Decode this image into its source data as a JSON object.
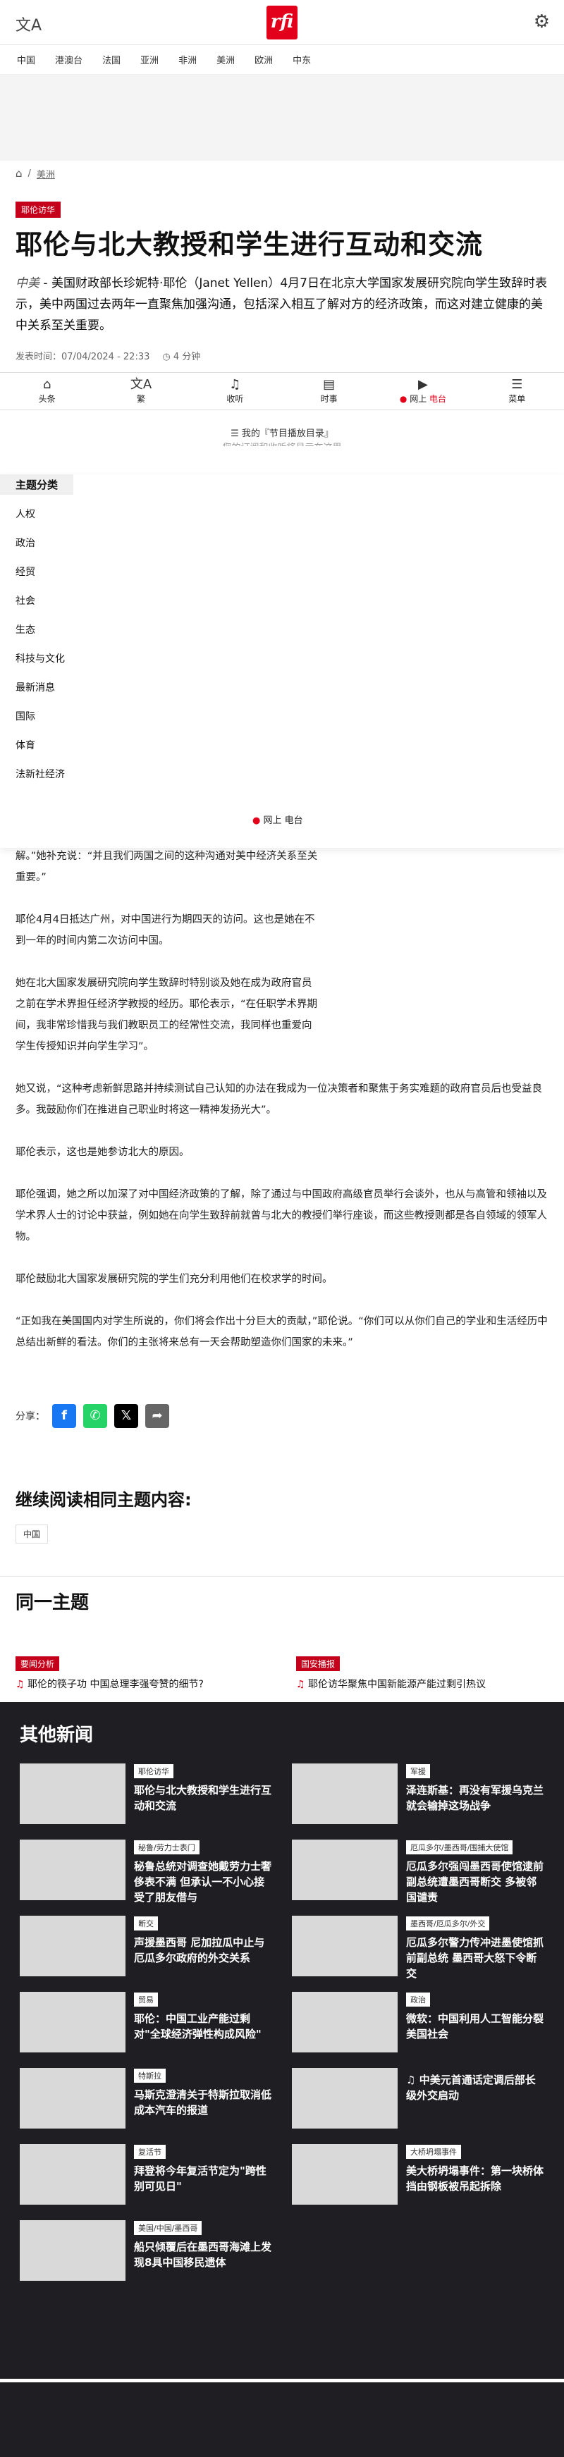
{
  "header": {
    "translate_icon": "translate-icon",
    "logo_text": "rfi",
    "settings_icon": "gear-icon"
  },
  "nav": [
    "中国",
    "港澳台",
    "法国",
    "亚洲",
    "非洲",
    "美洲",
    "欧洲",
    "中东"
  ],
  "breadcrumb": {
    "home_icon": "home-icon",
    "section": "美洲"
  },
  "article": {
    "tag": "耶伦访华",
    "title": "耶伦与北大教授和学生进行互动和交流",
    "lead_place": "中美",
    "lead_text": " - 美国财政部长珍妮特·耶伦（Janet Yellen）4月7日在北京大学国家发展研究院向学生致辞时表示，美中两国过去两年一直聚焦加强沟通，包括深入相互了解对方的经济政策，而这对建立健康的美中关系至关重要。",
    "published_label": "发表时间：",
    "published": "07/04/2024 - 22:33",
    "read_time": "4 分钟"
  },
  "bottom_nav": [
    {
      "icon": "home-icon",
      "label": "头条"
    },
    {
      "icon": "translate-icon",
      "label": "繁"
    },
    {
      "icon": "headphones-icon",
      "label": "收听"
    },
    {
      "icon": "news-icon",
      "label": "时事"
    },
    {
      "icon": "play-icon",
      "label": "网上",
      "label2": "电台"
    },
    {
      "icon": "menu-icon",
      "label": "菜单"
    }
  ],
  "schedule": {
    "text": "我的『节目播放目录』",
    "cut": "您的订阅和收听将显示在这里"
  },
  "topics": {
    "header": "主题分类",
    "items": [
      "人权",
      "政治",
      "经贸",
      "社会",
      "生态",
      "科技与文化",
      "最新消息",
      "国际",
      "体育",
      "法新社经济"
    ],
    "live_label": "网上 电台"
  },
  "body": {
    "p1": "解。”她补充说：“并且我们两国之间的这种沟通对美中经济关系至关重要。”",
    "p2": "耶伦4月4日抵达广州，对中国进行为期四天的访问。这也是她在不到一年的时间内第二次访问中国。",
    "p3": "她在北大国家发展研究院向学生致辞时特别谈及她在成为政府官员之前在学术界担任经济学教授的经历。耶伦表示，“在任职学术界期间，我非常珍惜我与我们教职员工的经常性交流，我同样也重爱向学生传授知识并向学生学习”。",
    "p4": "她又说，“这种考虑新鲜思路并持续测试自己认知的办法在我成为一位决策者和聚焦于务实难题的政府官员后也受益良多。我鼓励你们在推进自己职业时将这一精神发扬光大”。",
    "p5": "耶伦表示，这也是她参访北大的原因。",
    "p6": "耶伦强调，她之所以加深了对中国经济政策的了解，除了通过与中国政府高级官员举行会谈外，也从与高管和领袖以及学术界人士的讨论中获益，例如她在向学生致辞前就曾与北大的教授们举行座谈，而这些教授则都是各自领域的领军人物。",
    "p7": "耶伦鼓励北大国家发展研究院的学生们充分利用他们在校求学的时间。",
    "p8": "“正如我在美国国内对学生所说的，你们将会作出十分巨大的贡献，”耶伦说。“你们可以从你们自己的学业和生活经历中总结出新鲜的看法。你们的主张将来总有一天会帮助塑造你们国家的未来。”"
  },
  "share": {
    "label": "分享：",
    "icons": [
      "facebook-icon",
      "whatsapp-icon",
      "x-icon",
      "share-icon"
    ]
  },
  "continue": {
    "heading": "继续阅读相同主题内容:",
    "chip": "中国"
  },
  "same_topic": {
    "heading": "同一主题",
    "items": [
      {
        "badge": "要闻分析",
        "text": "耶伦的筷子功 中国总理李强夸赞的细节?"
      },
      {
        "badge": "国安播报",
        "text": "耶伦访华聚焦中国新能源产能过剩引热议"
      }
    ]
  },
  "other_news": {
    "heading": "其他新闻",
    "items": [
      {
        "badge": "耶伦访华",
        "title": "耶伦与北大教授和学生进行互动和交流"
      },
      {
        "badge": "军援",
        "title": "泽连斯基：再没有军援乌克兰就会输掉这场战争"
      },
      {
        "badge": "秘鲁/劳力士表门",
        "title": "秘鲁总统对调查她戴劳力士奢侈表不满 但承认一不小心接受了朋友借与"
      },
      {
        "badge": "厄瓜多尔/墨西哥/围捕大使馆",
        "title": "厄瓜多尔强闯墨西哥使馆逮前副总统遭墨西哥断交 多被邻国谴责"
      },
      {
        "badge": "断交",
        "title": "声援墨西哥 尼加拉瓜中止与厄瓜多尔政府的外交关系"
      },
      {
        "badge": "墨西哥/厄瓜多尔/外交",
        "title": "厄瓜多尔警力传冲进墨使馆抓前副总统 墨西哥大怒下令断交"
      },
      {
        "badge": "贸易",
        "title": "耶伦：中国工业产能过剩对\"全球经济弹性构成风险\""
      },
      {
        "badge": "政治",
        "title": "微软：中国利用人工智能分裂美国社会"
      },
      {
        "badge": "特斯拉",
        "title": "马斯克澄清关于特斯拉取消低成本汽车的报道"
      },
      {
        "badge": "",
        "title": "中美元首通话定调后部长级外交启动"
      },
      {
        "badge": "复活节",
        "title": "拜登将今年复活节定为\"跨性别可见日\""
      },
      {
        "badge": "大桥坍塌事件",
        "title": "美大桥坍塌事件：第一块桥体挡由钢板被吊起拆除"
      },
      {
        "badge": "美国/中国/墨西哥",
        "title": "船只倾覆后在墨西哥海滩上发现8具中国移民遗体"
      }
    ]
  }
}
